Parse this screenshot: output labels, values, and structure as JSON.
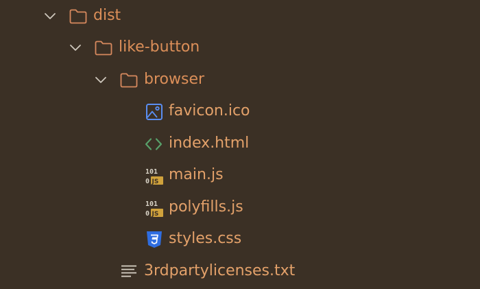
{
  "colors": {
    "background": "#3b3025",
    "folder_label": "#dc8f59",
    "file_label": "#e3a16a",
    "folder_icon": "#d7895e",
    "image_icon": "#5a8ef2",
    "html_icon": "#58a06a",
    "js_badge": "#d0a23c",
    "css_icon": "#2f6de0"
  },
  "tree": {
    "dist": {
      "label": "dist",
      "icon": "folder-icon",
      "expanded": true
    },
    "like_button": {
      "label": "like-button",
      "icon": "folder-icon",
      "expanded": true
    },
    "browser": {
      "label": "browser",
      "icon": "folder-icon",
      "expanded": true
    },
    "files": [
      {
        "label": "favicon.ico",
        "icon": "image-file-icon"
      },
      {
        "label": "index.html",
        "icon": "html-file-icon"
      },
      {
        "label": "main.js",
        "icon": "js-file-icon",
        "icon_text_top": "101",
        "icon_text_bottom": "0",
        "badge": "JS"
      },
      {
        "label": "polyfills.js",
        "icon": "js-file-icon",
        "icon_text_top": "101",
        "icon_text_bottom": "0",
        "badge": "JS"
      },
      {
        "label": "styles.css",
        "icon": "css-file-icon"
      }
    ],
    "licenses": {
      "label": "3rdpartylicenses.txt",
      "icon": "text-file-icon"
    }
  }
}
